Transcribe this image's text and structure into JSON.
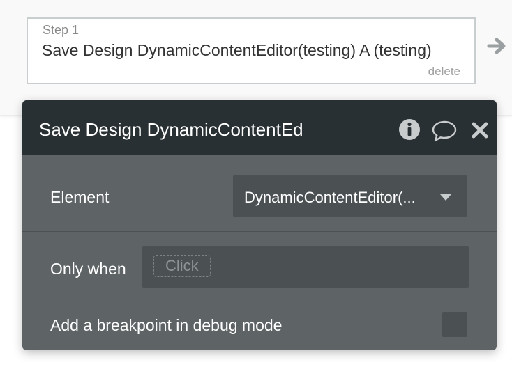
{
  "step": {
    "label": "Step 1",
    "title": "Save Design DynamicContentEditor(testing) A (testing)",
    "delete_label": "delete"
  },
  "panel": {
    "title": "Save Design DynamicContentEd",
    "element_label": "Element",
    "element_value": "DynamicContentEditor(...",
    "only_when_label": "Only when",
    "only_when_placeholder": "Click",
    "breakpoint_label": "Add a breakpoint in debug mode",
    "breakpoint_checked": false
  },
  "icons": {
    "next_step": "arrow-right-icon",
    "info": "info-icon",
    "comment": "comment-icon",
    "close": "close-icon",
    "dropdown": "caret-down-icon"
  },
  "colors": {
    "panel_header_bg": "#293033",
    "panel_body_bg": "#5e6366",
    "field_bg": "#4b5053",
    "step_border": "#c8cdd0"
  }
}
